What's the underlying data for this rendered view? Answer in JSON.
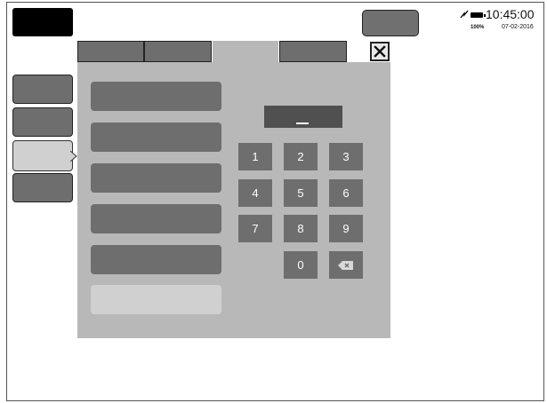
{
  "status": {
    "time": "10:45:00",
    "date": "07-02-2016",
    "battery_percent": "100%",
    "icons": [
      "signal-icon",
      "battery-icon"
    ]
  },
  "dialog": {
    "tabs": [
      {
        "state": "inactive"
      },
      {
        "state": "inactive"
      },
      {
        "state": "active"
      },
      {
        "state": "inactive"
      }
    ],
    "close_icon": "close-icon",
    "fields": [
      {
        "state": "enabled"
      },
      {
        "state": "enabled"
      },
      {
        "state": "enabled"
      },
      {
        "state": "enabled"
      },
      {
        "state": "enabled"
      },
      {
        "state": "disabled"
      }
    ],
    "keypad": {
      "display_value": "",
      "keys": [
        "1",
        "2",
        "3",
        "4",
        "5",
        "6",
        "7",
        "8",
        "9",
        "0"
      ],
      "backspace_icon": "backspace-icon"
    }
  },
  "sidebar": {
    "items": [
      {
        "state": "inactive"
      },
      {
        "state": "inactive"
      },
      {
        "state": "active"
      },
      {
        "state": "inactive"
      }
    ]
  },
  "colors": {
    "key_bg": "#6e6e6e",
    "panel_bg": "#b8b8b8",
    "display_bg": "#505050"
  }
}
